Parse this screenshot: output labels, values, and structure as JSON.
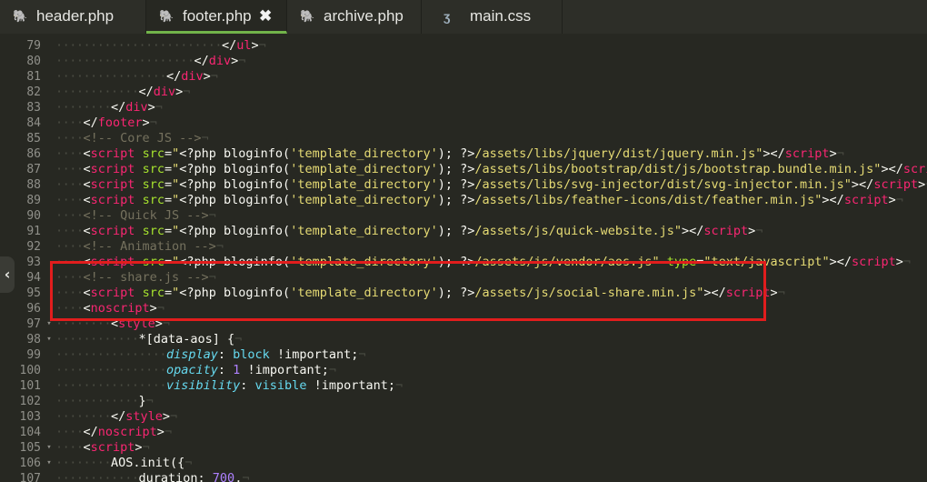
{
  "tabs": [
    {
      "label": "header.php",
      "icon": "php-elephant-icon",
      "active": false,
      "closable": false
    },
    {
      "label": "footer.php",
      "icon": "php-elephant-icon",
      "active": true,
      "closable": true
    },
    {
      "label": "archive.php",
      "icon": "php-elephant-icon",
      "active": false,
      "closable": false
    },
    {
      "label": "main.css",
      "icon": "css-file-icon",
      "active": false,
      "closable": false
    }
  ],
  "close_glyph": "✖",
  "editor": {
    "lines": [
      {
        "num": "79",
        "indent": 6,
        "tokens": [
          [
            "</",
            "t-plain"
          ],
          [
            "ul",
            "t-tag"
          ],
          [
            ">",
            "t-plain"
          ]
        ]
      },
      {
        "num": "80",
        "indent": 5,
        "tokens": [
          [
            "</",
            "t-plain"
          ],
          [
            "div",
            "t-tag"
          ],
          [
            ">",
            "t-plain"
          ]
        ]
      },
      {
        "num": "81",
        "indent": 4,
        "tokens": [
          [
            "</",
            "t-plain"
          ],
          [
            "div",
            "t-tag"
          ],
          [
            ">",
            "t-plain"
          ]
        ]
      },
      {
        "num": "82",
        "indent": 3,
        "tokens": [
          [
            "</",
            "t-plain"
          ],
          [
            "div",
            "t-tag"
          ],
          [
            ">",
            "t-plain"
          ]
        ]
      },
      {
        "num": "83",
        "indent": 2,
        "tokens": [
          [
            "</",
            "t-plain"
          ],
          [
            "div",
            "t-tag"
          ],
          [
            ">",
            "t-plain"
          ]
        ]
      },
      {
        "num": "84",
        "indent": 1,
        "tokens": [
          [
            "</",
            "t-plain"
          ],
          [
            "footer",
            "t-tag"
          ],
          [
            ">",
            "t-plain"
          ]
        ]
      },
      {
        "num": "85",
        "indent": 1,
        "tokens": [
          [
            "<!-- Core JS -->",
            "t-cmt"
          ]
        ]
      },
      {
        "num": "86",
        "indent": 1,
        "tokens": [
          [
            "<",
            "t-plain"
          ],
          [
            "script",
            "t-tag"
          ],
          [
            " ",
            "t-plain"
          ],
          [
            "src",
            "t-attr"
          ],
          [
            "=",
            "t-plain"
          ],
          [
            "\"",
            "t-str"
          ],
          [
            "<?php ",
            "t-php"
          ],
          [
            "bloginfo",
            "t-php"
          ],
          [
            "(",
            "t-plain"
          ],
          [
            "'template_directory'",
            "t-str"
          ],
          [
            "); ",
            "t-plain"
          ],
          [
            "?>",
            "t-php"
          ],
          [
            "/assets/libs/jquery/dist/jquery.min.js\"",
            "t-str"
          ],
          [
            "></",
            "t-plain"
          ],
          [
            "script",
            "t-tag"
          ],
          [
            ">",
            "t-plain"
          ]
        ]
      },
      {
        "num": "87",
        "indent": 1,
        "tokens": [
          [
            "<",
            "t-plain"
          ],
          [
            "script",
            "t-tag"
          ],
          [
            " ",
            "t-plain"
          ],
          [
            "src",
            "t-attr"
          ],
          [
            "=",
            "t-plain"
          ],
          [
            "\"",
            "t-str"
          ],
          [
            "<?php ",
            "t-php"
          ],
          [
            "bloginfo",
            "t-php"
          ],
          [
            "(",
            "t-plain"
          ],
          [
            "'template_directory'",
            "t-str"
          ],
          [
            "); ",
            "t-plain"
          ],
          [
            "?>",
            "t-php"
          ],
          [
            "/assets/libs/bootstrap/dist/js/bootstrap.bundle.min.js\"",
            "t-str"
          ],
          [
            "></",
            "t-plain"
          ],
          [
            "script",
            "t-tag"
          ],
          [
            ">",
            "t-plain"
          ]
        ]
      },
      {
        "num": "88",
        "indent": 1,
        "tokens": [
          [
            "<",
            "t-plain"
          ],
          [
            "script",
            "t-tag"
          ],
          [
            " ",
            "t-plain"
          ],
          [
            "src",
            "t-attr"
          ],
          [
            "=",
            "t-plain"
          ],
          [
            "\"",
            "t-str"
          ],
          [
            "<?php ",
            "t-php"
          ],
          [
            "bloginfo",
            "t-php"
          ],
          [
            "(",
            "t-plain"
          ],
          [
            "'template_directory'",
            "t-str"
          ],
          [
            "); ",
            "t-plain"
          ],
          [
            "?>",
            "t-php"
          ],
          [
            "/assets/libs/svg-injector/dist/svg-injector.min.js\"",
            "t-str"
          ],
          [
            "></",
            "t-plain"
          ],
          [
            "script",
            "t-tag"
          ],
          [
            ">",
            "t-plain"
          ]
        ]
      },
      {
        "num": "89",
        "indent": 1,
        "tokens": [
          [
            "<",
            "t-plain"
          ],
          [
            "script",
            "t-tag"
          ],
          [
            " ",
            "t-plain"
          ],
          [
            "src",
            "t-attr"
          ],
          [
            "=",
            "t-plain"
          ],
          [
            "\"",
            "t-str"
          ],
          [
            "<?php ",
            "t-php"
          ],
          [
            "bloginfo",
            "t-php"
          ],
          [
            "(",
            "t-plain"
          ],
          [
            "'template_directory'",
            "t-str"
          ],
          [
            "); ",
            "t-plain"
          ],
          [
            "?>",
            "t-php"
          ],
          [
            "/assets/libs/feather-icons/dist/feather.min.js\"",
            "t-str"
          ],
          [
            "></",
            "t-plain"
          ],
          [
            "script",
            "t-tag"
          ],
          [
            ">",
            "t-plain"
          ]
        ]
      },
      {
        "num": "90",
        "indent": 1,
        "tokens": [
          [
            "<!-- Quick JS -->",
            "t-cmt"
          ]
        ]
      },
      {
        "num": "91",
        "indent": 1,
        "tokens": [
          [
            "<",
            "t-plain"
          ],
          [
            "script",
            "t-tag"
          ],
          [
            " ",
            "t-plain"
          ],
          [
            "src",
            "t-attr"
          ],
          [
            "=",
            "t-plain"
          ],
          [
            "\"",
            "t-str"
          ],
          [
            "<?php ",
            "t-php"
          ],
          [
            "bloginfo",
            "t-php"
          ],
          [
            "(",
            "t-plain"
          ],
          [
            "'template_directory'",
            "t-str"
          ],
          [
            "); ",
            "t-plain"
          ],
          [
            "?>",
            "t-php"
          ],
          [
            "/assets/js/quick-website.js\"",
            "t-str"
          ],
          [
            "></",
            "t-plain"
          ],
          [
            "script",
            "t-tag"
          ],
          [
            ">",
            "t-plain"
          ]
        ]
      },
      {
        "num": "92",
        "indent": 1,
        "tokens": [
          [
            "<!-- Animation -->",
            "t-cmt"
          ]
        ]
      },
      {
        "num": "93",
        "indent": 1,
        "tokens": [
          [
            "<",
            "t-plain"
          ],
          [
            "script",
            "t-tag"
          ],
          [
            " ",
            "t-plain"
          ],
          [
            "src",
            "t-attr"
          ],
          [
            "=",
            "t-plain"
          ],
          [
            "\"",
            "t-str"
          ],
          [
            "<?php ",
            "t-php"
          ],
          [
            "bloginfo",
            "t-php"
          ],
          [
            "(",
            "t-plain"
          ],
          [
            "'template_directory'",
            "t-str"
          ],
          [
            "); ",
            "t-plain"
          ],
          [
            "?>",
            "t-php"
          ],
          [
            "/assets/js/vendor/aos.js\"",
            "t-str"
          ],
          [
            " ",
            "t-plain"
          ],
          [
            "type",
            "t-attr"
          ],
          [
            "=",
            "t-plain"
          ],
          [
            "\"text/javascript\"",
            "t-str"
          ],
          [
            "></",
            "t-plain"
          ],
          [
            "script",
            "t-tag"
          ],
          [
            ">",
            "t-plain"
          ]
        ]
      },
      {
        "num": "94",
        "indent": 1,
        "tokens": [
          [
            "<!-- share.js -->",
            "t-cmt"
          ]
        ]
      },
      {
        "num": "95",
        "indent": 1,
        "tokens": [
          [
            "<",
            "t-plain"
          ],
          [
            "script",
            "t-tag"
          ],
          [
            " ",
            "t-plain"
          ],
          [
            "src",
            "t-attr"
          ],
          [
            "=",
            "t-plain"
          ],
          [
            "\"",
            "t-str"
          ],
          [
            "<?php ",
            "t-php"
          ],
          [
            "bloginfo",
            "t-php"
          ],
          [
            "(",
            "t-plain"
          ],
          [
            "'template_directory'",
            "t-str"
          ],
          [
            "); ",
            "t-plain"
          ],
          [
            "?>",
            "t-php"
          ],
          [
            "/assets/js/social-share.min.js\"",
            "t-str"
          ],
          [
            "></",
            "t-plain"
          ],
          [
            "script",
            "t-tag"
          ],
          [
            ">",
            "t-plain"
          ]
        ]
      },
      {
        "num": "96",
        "indent": 1,
        "tokens": [
          [
            "<",
            "t-plain"
          ],
          [
            "noscript",
            "t-tag"
          ],
          [
            ">",
            "t-plain"
          ]
        ]
      },
      {
        "num": "97",
        "indent": 2,
        "fold": "▾",
        "tokens": [
          [
            "<",
            "t-plain"
          ],
          [
            "style",
            "t-tag"
          ],
          [
            ">",
            "t-plain"
          ]
        ]
      },
      {
        "num": "98",
        "indent": 3,
        "fold": "▾",
        "tokens": [
          [
            "*[data-aos] {",
            "t-plain"
          ]
        ]
      },
      {
        "num": "99",
        "indent": 4,
        "tokens": [
          [
            "display",
            "t-prop"
          ],
          [
            ": ",
            "t-plain"
          ],
          [
            "block",
            "t-val"
          ],
          [
            " !important;",
            "t-plain"
          ]
        ]
      },
      {
        "num": "100",
        "indent": 4,
        "tokens": [
          [
            "opacity",
            "t-prop"
          ],
          [
            ": ",
            "t-plain"
          ],
          [
            "1",
            "t-num"
          ],
          [
            " !important;",
            "t-plain"
          ]
        ]
      },
      {
        "num": "101",
        "indent": 4,
        "tokens": [
          [
            "visibility",
            "t-prop"
          ],
          [
            ": ",
            "t-plain"
          ],
          [
            "visible",
            "t-val"
          ],
          [
            " !important;",
            "t-plain"
          ]
        ]
      },
      {
        "num": "102",
        "indent": 3,
        "tokens": [
          [
            "}",
            "t-plain"
          ]
        ]
      },
      {
        "num": "103",
        "indent": 2,
        "tokens": [
          [
            "</",
            "t-plain"
          ],
          [
            "style",
            "t-tag"
          ],
          [
            ">",
            "t-plain"
          ]
        ]
      },
      {
        "num": "104",
        "indent": 1,
        "tokens": [
          [
            "</",
            "t-plain"
          ],
          [
            "noscript",
            "t-tag"
          ],
          [
            ">",
            "t-plain"
          ]
        ]
      },
      {
        "num": "105",
        "indent": 1,
        "fold": "▾",
        "tokens": [
          [
            "<",
            "t-plain"
          ],
          [
            "script",
            "t-tag"
          ],
          [
            ">",
            "t-plain"
          ]
        ]
      },
      {
        "num": "106",
        "indent": 2,
        "fold": "▾",
        "tokens": [
          [
            "AOS.init({",
            "t-plain"
          ]
        ]
      },
      {
        "num": "107",
        "indent": 3,
        "tokens": [
          [
            "duration",
            "t-plain"
          ],
          [
            ": ",
            "t-plain"
          ],
          [
            "700",
            "t-num"
          ],
          [
            ",",
            "t-plain"
          ]
        ]
      }
    ]
  },
  "left_handle_glyph": "‹"
}
